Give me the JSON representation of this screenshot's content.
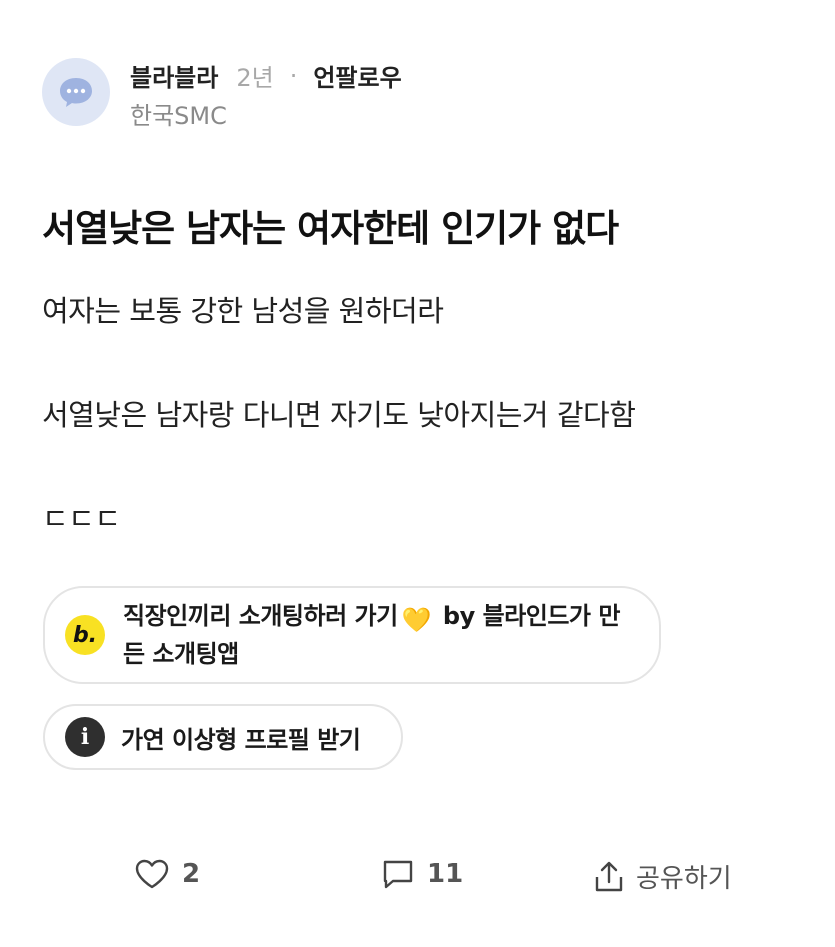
{
  "author": {
    "name": "블라블라",
    "age": "2년",
    "separator": "·",
    "unfollow_label": "언팔로우",
    "company": "한국SMC",
    "avatar_icon": "chat-bubble-icon",
    "avatar_color": "#dfe6f5"
  },
  "post": {
    "title": "서열낮은 남자는 여자한테 인기가 없다",
    "body": [
      "여자는 보통 강한 남성을 원하더라",
      "서열낮은 남자랑 다니면 자기도 낮아지는거 같다함",
      "ㄷㄷㄷ"
    ]
  },
  "ad": {
    "badge": "b.",
    "text_before": "직장인끼리 소개팅하러 가기",
    "emoji": "💛",
    "text_after": " by 블라인드가 만든 소개팅앱",
    "badge_color": "#f8e123"
  },
  "profile_chip": {
    "badge": "i",
    "label": "가연 이상형 프로필 받기"
  },
  "actions": {
    "likes": "2",
    "comments": "11",
    "share_label": "공유하기"
  }
}
